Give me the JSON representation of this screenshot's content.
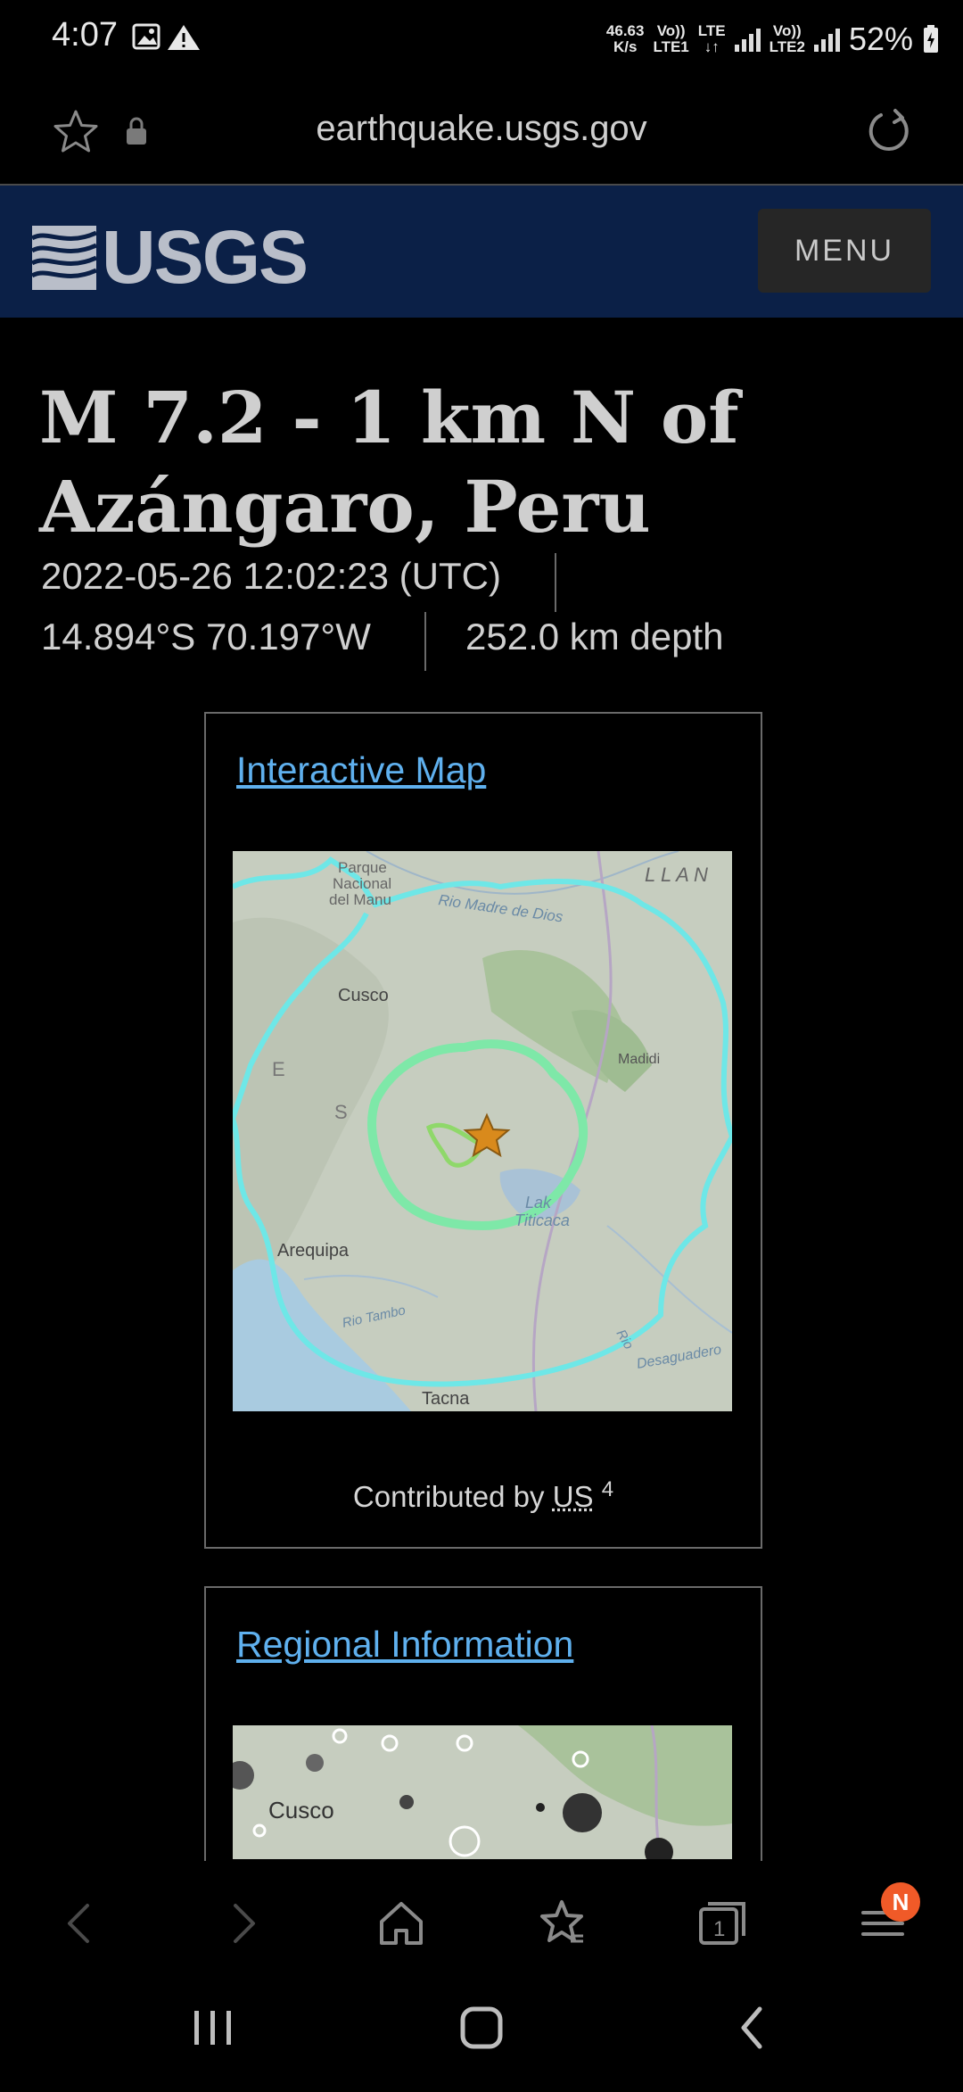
{
  "status_bar": {
    "time": "4:07",
    "net_speed_value": "46.63",
    "net_speed_unit": "K/s",
    "sim1_top": "Vo))",
    "sim1_bottom": "LTE1",
    "lte_label": "LTE",
    "sim2_top": "Vo))",
    "sim2_bottom": "LTE2",
    "battery": "52%",
    "icons": [
      "gallery-icon",
      "warning-icon",
      "signal-icon",
      "battery-charging-icon"
    ]
  },
  "address_bar": {
    "url": "earthquake.usgs.gov",
    "icons": [
      "star-outline-icon",
      "lock-icon",
      "reload-icon"
    ]
  },
  "header": {
    "logo_text": "USGS",
    "menu_label": "MENU",
    "background": "#0b2047"
  },
  "event": {
    "title": "M 7.2 - 1 km N of Azángaro, Peru",
    "datetime": "2022-05-26 12:02:23 (UTC)",
    "coordinates": "14.894°S 70.197°W",
    "depth": "252.0 km depth"
  },
  "cards": {
    "interactive_map": {
      "link": "Interactive Map",
      "contributed_prefix": "Contributed by ",
      "contributor": "US",
      "contributor_count": "4",
      "map_labels": {
        "parque_line1": "Parque",
        "parque_line2": "Nacional",
        "parque_line3": "del Manu",
        "llan": "L L A N",
        "madre_de_dios": "Rio Madre de Dios",
        "cusco": "Cusco",
        "madidi": "Madidi",
        "andes_e": "E",
        "andes_s": "S",
        "lake_line1": "Lak",
        "lake_line2": "Titicaca",
        "arequipa": "Arequipa",
        "rio_tambo": "Rio Tambo",
        "tacna": "Tacna",
        "desaguadero": "Desaguadero",
        "rio_short": "Rio"
      }
    },
    "regional": {
      "link": "Regional Information",
      "map_label": "Cusco"
    }
  },
  "browser_toolbar": {
    "items": [
      "back-icon",
      "forward-icon",
      "home-icon",
      "bookmarks-icon",
      "tabs-icon",
      "menu-icon"
    ],
    "tabs_count": "1",
    "notification_badge": "N",
    "badge_color": "#f05a28"
  },
  "system_nav": [
    "recents-icon",
    "home-nav-icon",
    "back-nav-icon"
  ],
  "colors": {
    "link": "#5fb0ee",
    "shakemap_outer": "#6ee7e7",
    "shakemap_inner": "#7ee8a8",
    "epicenter": "#d98a1c"
  }
}
